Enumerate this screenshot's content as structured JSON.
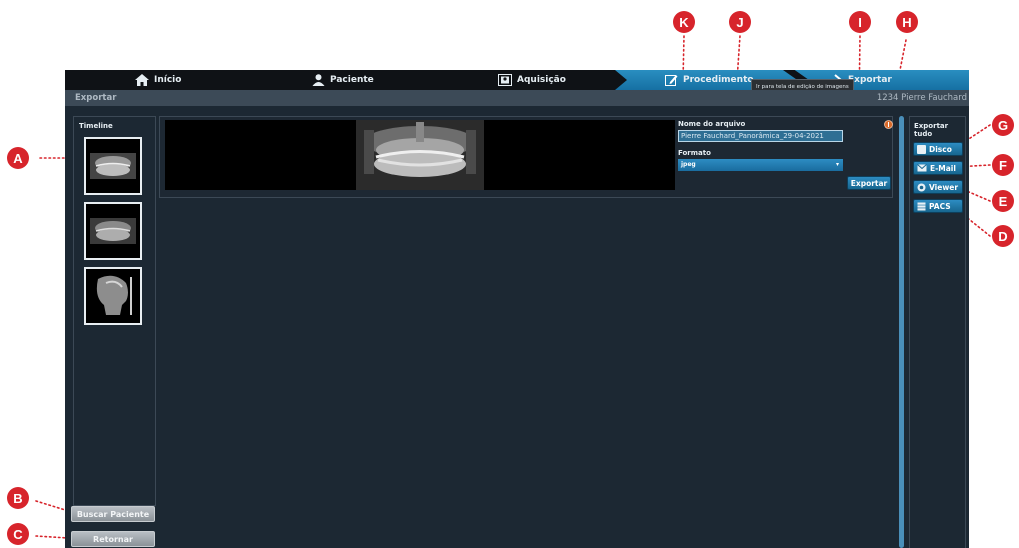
{
  "nav": {
    "items": [
      {
        "label": "Início",
        "icon": "home-icon"
      },
      {
        "label": "Paciente",
        "icon": "person-icon"
      },
      {
        "label": "Aquisição",
        "icon": "acquisition-icon"
      },
      {
        "label": "Procedimento",
        "icon": "edit-icon"
      },
      {
        "label": "Exportar",
        "icon": "chevron-right-icon"
      }
    ],
    "active": "Exportar",
    "tooltip": "Ir para tela de edição de imagens"
  },
  "subbar": {
    "title": "Exportar",
    "patient": "1234 Pierre Fauchard"
  },
  "timeline": {
    "title": "Timeline",
    "items": [
      "panoramic-thumbnail",
      "panoramic-thumbnail",
      "cephalometric-thumbnail"
    ]
  },
  "left_buttons": {
    "search": "Buscar Paciente",
    "back": "Retornar"
  },
  "export_form": {
    "filename_label": "Nome do arquivo",
    "filename_value": "Pierre Fauchard_Panorâmica_29-04-2021",
    "format_label": "Formato",
    "format_value": "jpeg",
    "export_button": "Exportar"
  },
  "export_all": {
    "title": "Exportar tudo",
    "buttons": [
      {
        "label": "Disco",
        "icon": "disk-icon"
      },
      {
        "label": "E-Mail",
        "icon": "mail-icon"
      },
      {
        "label": "Viewer",
        "icon": "viewer-icon"
      },
      {
        "label": "PACS",
        "icon": "pacs-icon"
      }
    ]
  },
  "callouts": [
    "A",
    "B",
    "C",
    "D",
    "E",
    "F",
    "G",
    "H",
    "I",
    "J",
    "K"
  ],
  "colors": {
    "accent": "#1f80b4",
    "callout": "#d7242b",
    "background": "#1c2833"
  }
}
